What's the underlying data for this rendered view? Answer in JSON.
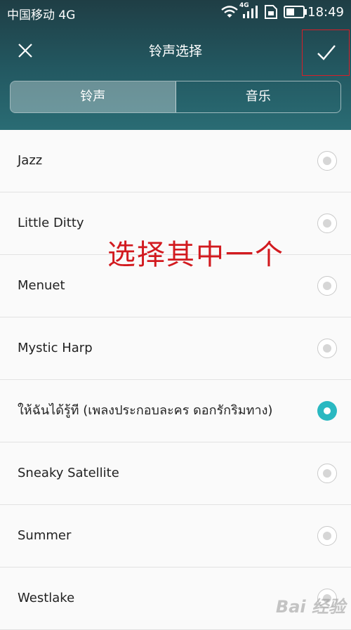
{
  "status_bar": {
    "carrier": "中国移动 4G",
    "network_badge": "4G",
    "time": "18:49"
  },
  "title_bar": {
    "title": "铃声选择",
    "close_icon": "close-icon",
    "confirm_icon": "check-icon"
  },
  "tabs": [
    {
      "label": "铃声",
      "selected": true
    },
    {
      "label": "音乐",
      "selected": false
    }
  ],
  "ringtones": [
    {
      "label": "Jazz",
      "selected": false
    },
    {
      "label": "Little Ditty",
      "selected": false
    },
    {
      "label": "Menuet",
      "selected": false
    },
    {
      "label": "Mystic Harp",
      "selected": false
    },
    {
      "label": "ให้ฉันได้รู้ที (เพลงประกอบละคร ดอกรักริมทาง)",
      "selected": true
    },
    {
      "label": "Sneaky Satellite",
      "selected": false
    },
    {
      "label": "Summer",
      "selected": false
    },
    {
      "label": "Westlake",
      "selected": false
    }
  ],
  "annotation": "选择其中一个",
  "watermark": "Bai 经验",
  "colors": {
    "header": "#235962",
    "accent": "#2ab8c1",
    "annotation": "#d21a1f",
    "highlight_box": "#d81e28"
  }
}
